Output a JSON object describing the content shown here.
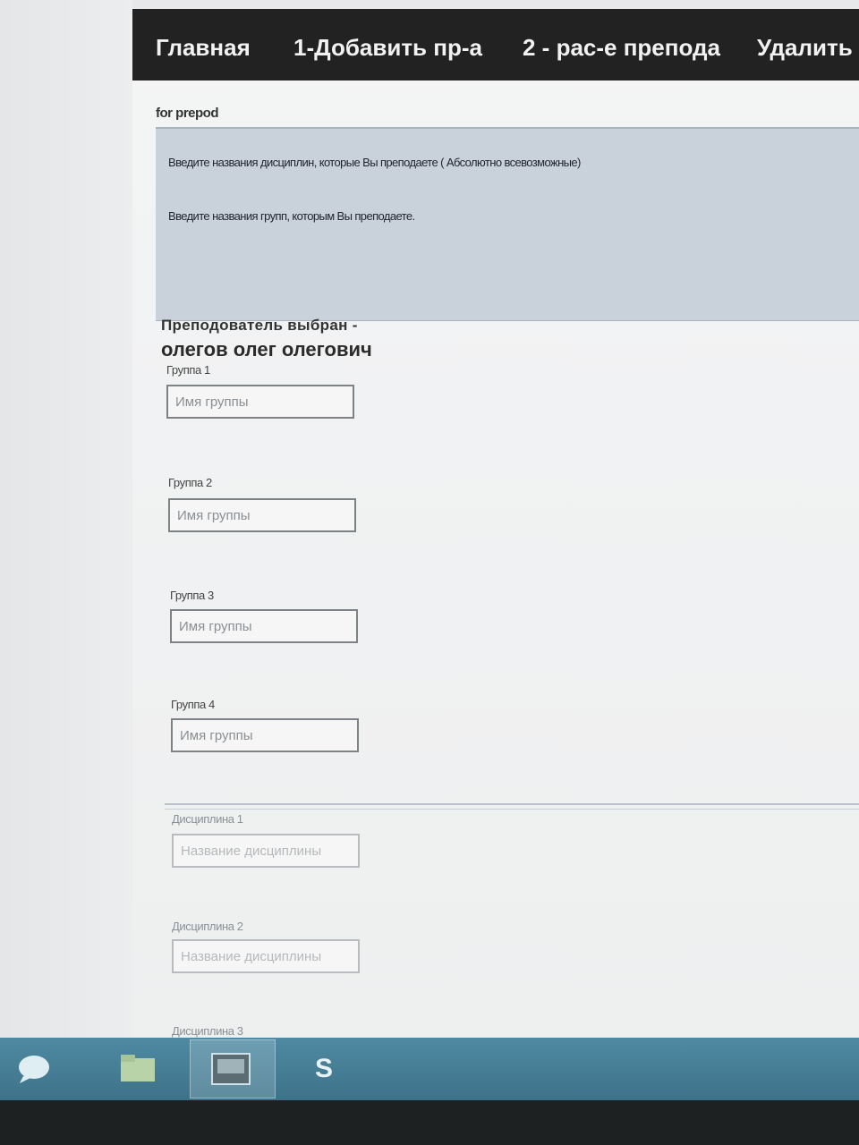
{
  "nav": {
    "items": [
      {
        "label": "Главная"
      },
      {
        "label": "1-Добавить пр-а"
      },
      {
        "label": "2 - рас-е препода"
      },
      {
        "label": "Удалить"
      }
    ]
  },
  "form": {
    "title": "for prepod",
    "info_line1": "Введите названия дисциплин, которые Вы преподаете ( Абсолютно всевозможные)",
    "info_line2": "Введите названия групп, которым Вы преподаете."
  },
  "teacher": {
    "label": "Преподователь выбран -",
    "name": "олегов олег олегович"
  },
  "groups": [
    {
      "label": "Группа 1",
      "placeholder": "Имя группы",
      "value": ""
    },
    {
      "label": "Группа 2",
      "placeholder": "Имя группы",
      "value": ""
    },
    {
      "label": "Группа 3",
      "placeholder": "Имя группы",
      "value": ""
    },
    {
      "label": "Группа 4",
      "placeholder": "Имя группы",
      "value": ""
    }
  ],
  "disciplines": [
    {
      "label": "Дисциплина 1",
      "placeholder": "Название дисциплины",
      "value": ""
    },
    {
      "label": "Дисциплина 2",
      "placeholder": "Название дисциплины",
      "value": ""
    },
    {
      "label": "Дисциплина 3"
    }
  ],
  "taskbar": {
    "icons": [
      "chat-icon",
      "folder-icon",
      "window-icon",
      "skype-icon"
    ],
    "skype_glyph": "S"
  },
  "colors": {
    "navbar_bg": "#222222",
    "info_box_bg": "#c9d1da",
    "taskbar_bg": "#4e8aa2"
  }
}
